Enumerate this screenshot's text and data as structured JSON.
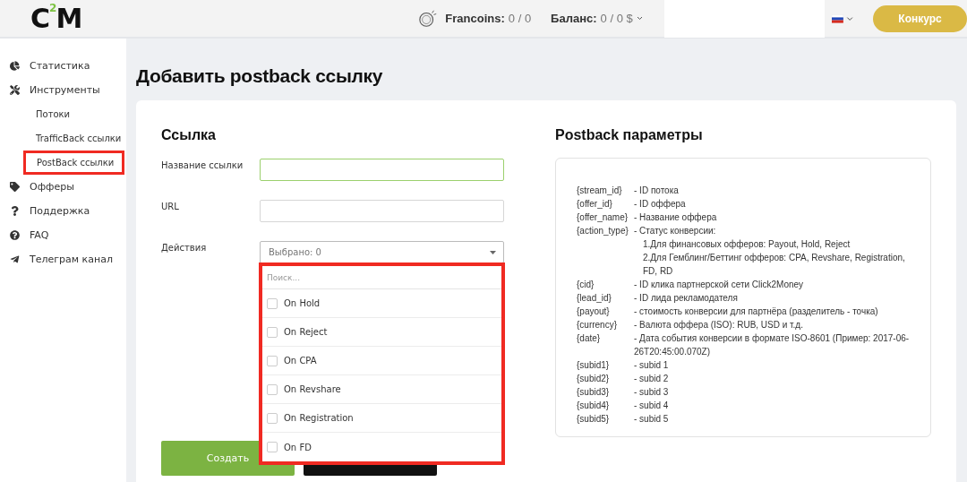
{
  "header": {
    "logo": {
      "letter_1": "C",
      "superscript": "2",
      "letter_2": "M"
    },
    "francoins": {
      "label": "Francoins:",
      "value": "0 / 0"
    },
    "balance": {
      "label": "Баланс:",
      "value": "0 / 0 $"
    },
    "contest_button": "Конкурс"
  },
  "sidebar": {
    "items": [
      {
        "label": "Статистика",
        "kind": "icon",
        "highlighted": false
      },
      {
        "label": "Инструменты",
        "kind": "icon",
        "highlighted": false,
        "children": [
          {
            "label": "Потоки",
            "highlighted": false
          },
          {
            "label": "TrafficBack ссылки",
            "highlighted": false
          },
          {
            "label": "PostBack ссылки",
            "highlighted": true
          }
        ]
      },
      {
        "label": "Офферы",
        "kind": "icon",
        "highlighted": false
      },
      {
        "label": "Поддержка",
        "kind": "icon",
        "highlighted": false
      },
      {
        "label": "FAQ",
        "kind": "icon",
        "highlighted": false
      },
      {
        "label": "Телеграм канал",
        "kind": "icon",
        "highlighted": false
      }
    ]
  },
  "page_title": "Добавить postback ссылку",
  "form": {
    "title": "Ссылка",
    "fields": [
      {
        "label": "Название ссылки",
        "focused": true
      },
      {
        "label": "URL",
        "focused": false
      }
    ],
    "actions": {
      "label": "Действия",
      "value": "Выбрано: 0",
      "expanded": true,
      "highlighted": true,
      "search_placeholder": "Поиск...",
      "options": [
        {
          "label": "On Hold",
          "checked": false
        },
        {
          "label": "On Reject",
          "checked": false
        },
        {
          "label": "On CPA",
          "checked": false
        },
        {
          "label": "On Revshare",
          "checked": false
        },
        {
          "label": "On Registration",
          "checked": false
        },
        {
          "label": "On FD",
          "checked": false
        }
      ]
    },
    "create_button": "Создать"
  },
  "params": {
    "title": "Postback параметры",
    "rows": [
      {
        "name": "{stream_id}",
        "lines": [
          "- ID потока"
        ]
      },
      {
        "name": "{offer_id}",
        "lines": [
          "- ID оффера"
        ]
      },
      {
        "name": "{offer_name}",
        "lines": [
          "- Название оффера"
        ]
      },
      {
        "name": "{action_type}",
        "lines": [
          "- Статус конверсии:",
          "1.Для финансовых офферов: Payout, Hold, Reject",
          "2.Для Гемблинг/Беттинг офферов: CPA, Revshare, Registration, FD, RD"
        ]
      },
      {
        "name": "{cid}",
        "lines": [
          "- ID клика партнерской сети Click2Money"
        ]
      },
      {
        "name": "{lead_id}",
        "lines": [
          "- ID лида рекламодателя"
        ]
      },
      {
        "name": "{payout}",
        "lines": [
          "- стоимость конверсии для партнёра (разделитель - точка)"
        ]
      },
      {
        "name": "{currency}",
        "lines": [
          "- Валюта оффера (ISO): RUB, USD и т.д."
        ]
      },
      {
        "name": "{date}",
        "lines": [
          "- Дата события конверсии в формате ISO-8601 (Пример: 2017-06-26T20:45:00.070Z)"
        ]
      },
      {
        "name": "{subid1}",
        "lines": [
          "- subid 1"
        ]
      },
      {
        "name": "{subid2}",
        "lines": [
          "- subid 2"
        ]
      },
      {
        "name": "{subid3}",
        "lines": [
          "- subid 3"
        ]
      },
      {
        "name": "{subid4}",
        "lines": [
          "- subid 4"
        ]
      },
      {
        "name": "{subid5}",
        "lines": [
          "- subid 5"
        ]
      }
    ]
  }
}
